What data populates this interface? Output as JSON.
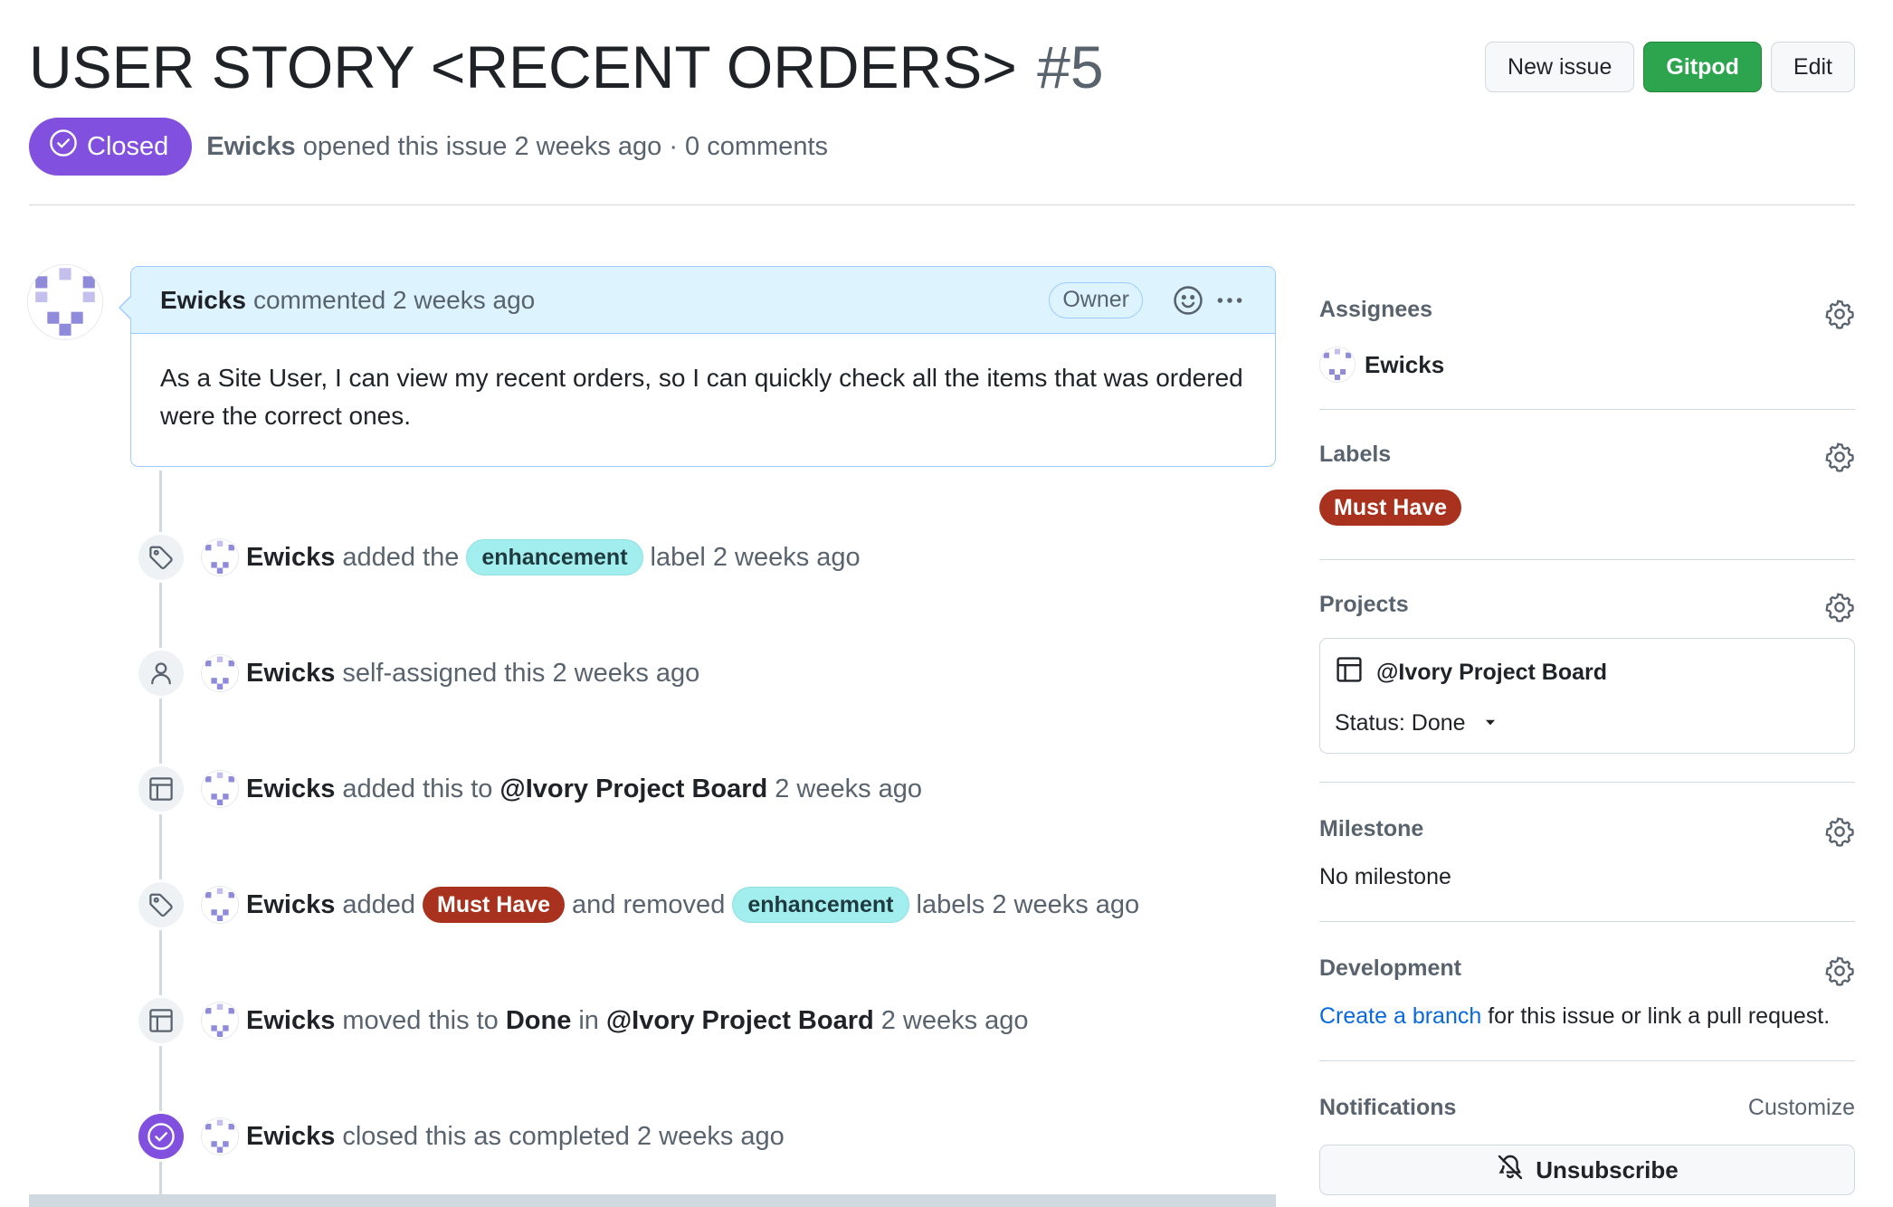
{
  "header": {
    "title": "USER STORY <RECENT ORDERS>",
    "number": "#5",
    "buttons": {
      "new_issue": "New issue",
      "gitpod": "Gitpod",
      "edit": "Edit"
    }
  },
  "status": {
    "badge": "Closed",
    "author": "Ewicks",
    "meta": "opened this issue 2 weeks ago · 0 comments"
  },
  "comment": {
    "author": "Ewicks",
    "meta": "commented 2 weeks ago",
    "role": "Owner",
    "body": "As a Site User, I can view my recent orders, so I can quickly check all the items that was ordered were the correct ones."
  },
  "timeline": [
    {
      "icon": "tag-icon",
      "user": "Ewicks",
      "t1": "added the",
      "label": "enhancement",
      "t2": "label 2 weeks ago"
    },
    {
      "icon": "person-icon",
      "user": "Ewicks",
      "t1": "self-assigned this 2 weeks ago"
    },
    {
      "icon": "table-icon",
      "user": "Ewicks",
      "t1": "added this to",
      "project": "@Ivory Project Board",
      "t2": "2 weeks ago"
    },
    {
      "icon": "tag-icon",
      "user": "Ewicks",
      "t1": "added",
      "label_added": "Must Have",
      "t2": "and removed",
      "label_removed": "enhancement",
      "t3": "labels 2 weeks ago"
    },
    {
      "icon": "table-icon",
      "user": "Ewicks",
      "t1": "moved this to",
      "column": "Done",
      "t2": "in",
      "project": "@Ivory Project Board",
      "t3": "2 weeks ago"
    },
    {
      "icon": "check-circle-icon",
      "user": "Ewicks",
      "t1": "closed this as completed 2 weeks ago"
    }
  ],
  "sidebar": {
    "assignees": {
      "title": "Assignees",
      "name": "Ewicks"
    },
    "labels": {
      "title": "Labels",
      "label": "Must Have"
    },
    "projects": {
      "title": "Projects",
      "name": "@Ivory Project Board",
      "status": "Status: Done"
    },
    "milestone": {
      "title": "Milestone",
      "value": "No milestone"
    },
    "development": {
      "title": "Development",
      "link": "Create a branch",
      "rest": "for this issue or link a pull request."
    },
    "notifications": {
      "title": "Notifications",
      "customize": "Customize",
      "button": "Unsubscribe"
    }
  },
  "colors": {
    "closed": "#8250df",
    "must_have": "#a8321e",
    "enhancement": "#a2eeef",
    "link": "#0969da",
    "gitpod": "#2da44e"
  }
}
